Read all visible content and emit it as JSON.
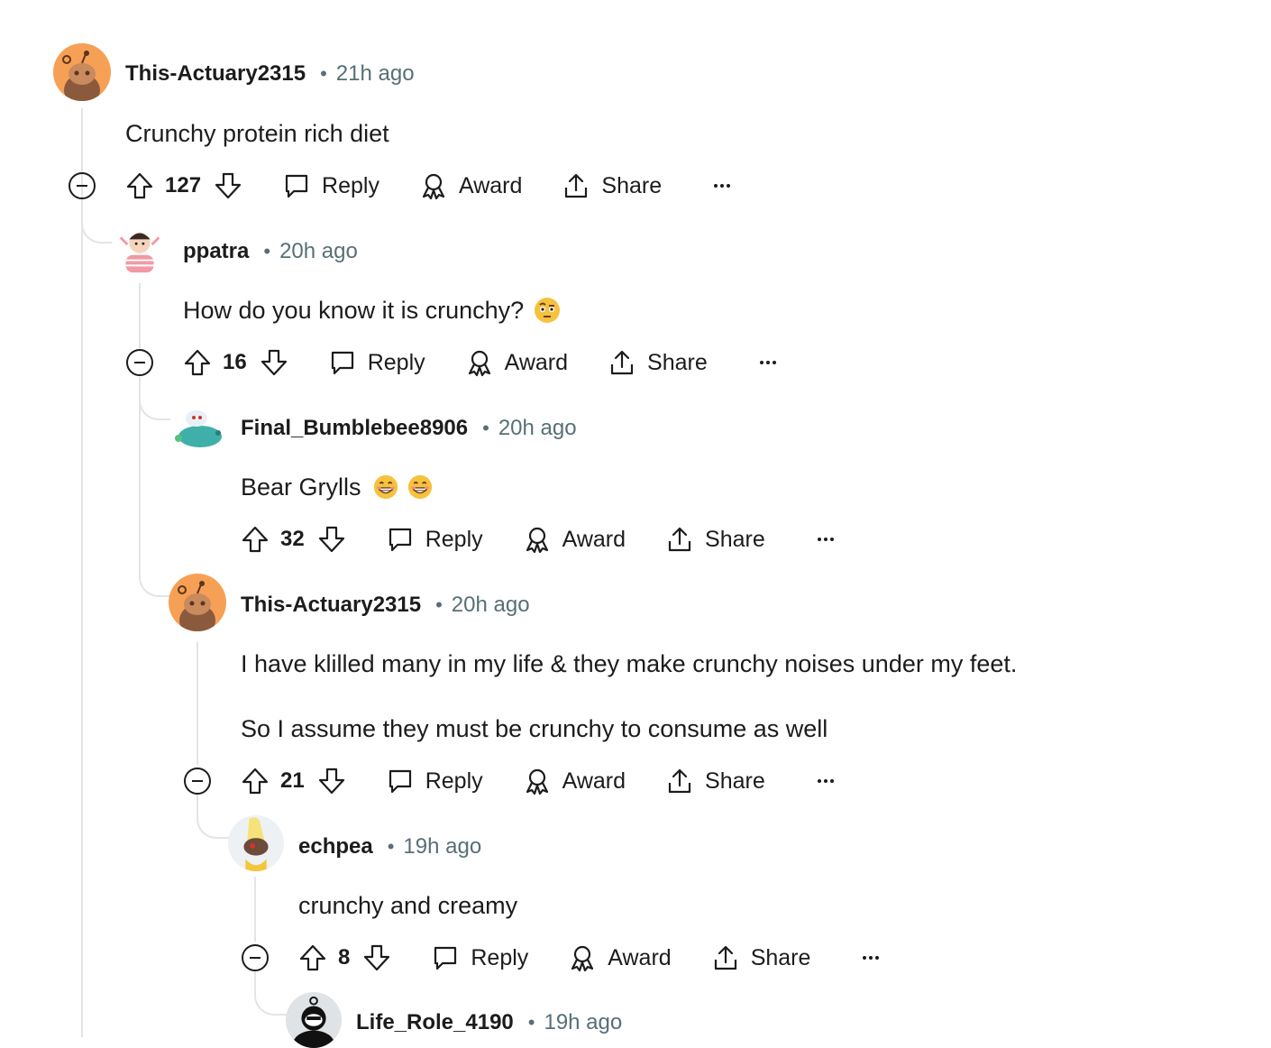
{
  "comments": [
    {
      "author": "This-Actuary2315",
      "time": "21h ago",
      "lines": [
        "Crunchy protein rich diet"
      ],
      "votes": "127",
      "avatar": "snoo-orange-avatar"
    },
    {
      "author": "ppatra",
      "time": "20h ago",
      "lines": [
        "How do you know it is crunchy?"
      ],
      "emoji": [
        "face-with-raised-eyebrow-emoji"
      ],
      "votes": "16",
      "avatar": "custom-avatar-pink"
    },
    {
      "author": "Final_Bumblebee8906",
      "time": "20h ago",
      "lines": [
        "Bear Grylls"
      ],
      "emoji": [
        "grinning-face-emoji",
        "grinning-face-emoji"
      ],
      "votes": "32",
      "avatar": "custom-avatar-teal"
    },
    {
      "author": "This-Actuary2315",
      "time": "20h ago",
      "lines": [
        "I have klilled many in my life & they make crunchy noises under my feet.",
        "So I assume they must be crunchy to consume as well"
      ],
      "votes": "21",
      "avatar": "snoo-orange-avatar"
    },
    {
      "author": "echpea",
      "time": "19h ago",
      "lines": [
        "crunchy and creamy"
      ],
      "votes": "8",
      "avatar": "custom-avatar-yellow"
    },
    {
      "author": "Life_Role_4190",
      "time": "19h ago",
      "avatar": "custom-avatar-black"
    }
  ],
  "actions": {
    "reply": "Reply",
    "award": "Award",
    "share": "Share"
  },
  "separator": "•",
  "icons": [
    "upvote-icon",
    "downvote-icon",
    "comment-bubble-icon",
    "award-ribbon-icon",
    "share-upload-icon",
    "more-options-icon",
    "collapse-thread-icon"
  ],
  "colors": {
    "text": "#1c1c1c",
    "meta": "#576f76",
    "thread_line": "#e2e4e7",
    "snoo_bg": "#f6a055"
  }
}
